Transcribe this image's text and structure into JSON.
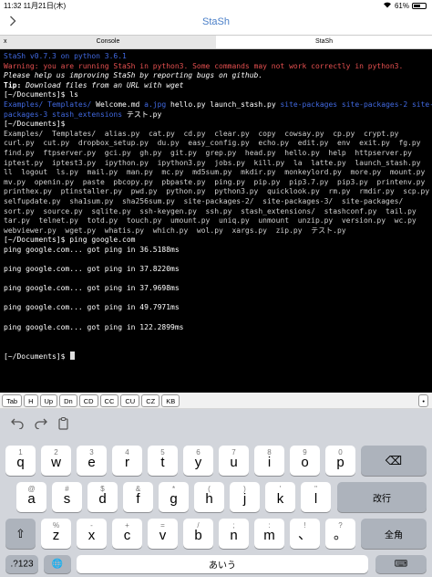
{
  "status_bar": {
    "time": "11:32",
    "date": "11月21日(木)",
    "battery_pct": "61%",
    "battery_level": 0.61
  },
  "nav": {
    "back_icon": "chevron-right-icon",
    "title": "StaSh"
  },
  "tabs": [
    {
      "label": "Console",
      "close": "x",
      "active": false
    },
    {
      "label": "StaSh",
      "active": true
    }
  ],
  "terminal": {
    "lines": [
      {
        "segments": [
          {
            "t": "StaSh v0.7.3 on python 3.6.1",
            "c": "blue"
          }
        ]
      },
      {
        "segments": [
          {
            "t": "Warning: you are running StaSh in python3. Some commands may not work correctly in python3.",
            "c": "red"
          }
        ]
      },
      {
        "segments": [
          {
            "t": "Please help us improving StaSh by reporting bugs on github.",
            "c": "white",
            "i": true
          }
        ]
      },
      {
        "segments": [
          {
            "t": "Tip: ",
            "c": "white",
            "b": true
          },
          {
            "t": "Download files from an URL with wget",
            "c": "white",
            "i": true
          }
        ]
      },
      {
        "segments": [
          {
            "t": "[~/Documents]$ ls",
            "c": "white"
          }
        ]
      },
      {
        "segments": [
          {
            "t": "Examples/ Templates/ ",
            "c": "blue"
          },
          {
            "t": "Welcome.md ",
            "c": "white"
          },
          {
            "t": "a.jpg ",
            "c": "blue"
          },
          {
            "t": "hello.py launch_stash.py ",
            "c": "white"
          },
          {
            "t": "site-packages site-packages-2 site-",
            "c": "blue"
          }
        ]
      },
      {
        "segments": [
          {
            "t": "packages-3 stash_extensions ",
            "c": "blue"
          },
          {
            "t": "テスト.py",
            "c": "white"
          }
        ]
      },
      {
        "segments": [
          {
            "t": "[~/Documents]$",
            "c": "white"
          }
        ]
      },
      {
        "segments": [
          {
            "t": "Examples/  Templates/  alias.py  cat.py  cd.py  clear.py  copy  cowsay.py  cp.py  crypt.py",
            "c": "gray"
          }
        ]
      },
      {
        "segments": [
          {
            "t": "curl.py  cut.py  dropbox_setup.py  du.py  easy_config.py  echo.py  edit.py  env  exit.py  fg.py",
            "c": "gray"
          }
        ]
      },
      {
        "segments": [
          {
            "t": "find.py  ftpserver.py  gci.py  gh.py  git.py  grep.py  head.py  hello.py  help  httpserver.py",
            "c": "gray"
          }
        ]
      },
      {
        "segments": [
          {
            "t": "iptest.py  iptest3.py  ipython.py  ipython3.py  jobs.py  kill.py  la  latte.py  launch_stash.py",
            "c": "gray"
          }
        ]
      },
      {
        "segments": [
          {
            "t": "ll  logout  ls.py  mail.py  man.py  mc.py  md5sum.py  mkdir.py  monkeylord.py  more.py  mount.py",
            "c": "gray"
          }
        ]
      },
      {
        "segments": [
          {
            "t": "mv.py  openin.py  paste  pbcopy.py  pbpaste.py  ping.py  pip.py  pip3.7.py  pip3.py  printenv.py",
            "c": "gray"
          }
        ]
      },
      {
        "segments": [
          {
            "t": "printhex.py  ptinstaller.py  pwd.py  python.py  python3.py  quicklook.py  rm.py  rmdir.py  scp.py",
            "c": "gray"
          }
        ]
      },
      {
        "segments": [
          {
            "t": "selfupdate.py  sha1sum.py  sha256sum.py  site-packages-2/  site-packages-3/  site-packages/",
            "c": "gray"
          }
        ]
      },
      {
        "segments": [
          {
            "t": "sort.py  source.py  sqlite.py  ssh-keygen.py  ssh.py  stash_extensions/  stashconf.py  tail.py",
            "c": "gray"
          }
        ]
      },
      {
        "segments": [
          {
            "t": "tar.py  telnet.py  totd.py  touch.py  umount.py  uniq.py  unmount  unzip.py  version.py  wc.py",
            "c": "gray"
          }
        ]
      },
      {
        "segments": [
          {
            "t": "webviewer.py  wget.py  whatis.py  which.py  wol.py  xargs.py  zip.py  テスト.py",
            "c": "gray"
          }
        ]
      },
      {
        "segments": [
          {
            "t": "[~/Documents]$ ping google.com",
            "c": "white"
          }
        ]
      },
      {
        "segments": [
          {
            "t": "ping google.com... got ping in 36.5188ms",
            "c": "white"
          }
        ]
      },
      {
        "segments": [
          {
            "t": "",
            "c": "white"
          }
        ]
      },
      {
        "segments": [
          {
            "t": "ping google.com... got ping in 37.8220ms",
            "c": "white"
          }
        ]
      },
      {
        "segments": [
          {
            "t": "",
            "c": "white"
          }
        ]
      },
      {
        "segments": [
          {
            "t": "ping google.com... got ping in 37.9698ms",
            "c": "white"
          }
        ]
      },
      {
        "segments": [
          {
            "t": "",
            "c": "white"
          }
        ]
      },
      {
        "segments": [
          {
            "t": "ping google.com... got ping in 49.7971ms",
            "c": "white"
          }
        ]
      },
      {
        "segments": [
          {
            "t": "",
            "c": "white"
          }
        ]
      },
      {
        "segments": [
          {
            "t": "ping google.com... got ping in 122.2899ms",
            "c": "white"
          }
        ]
      },
      {
        "segments": [
          {
            "t": "",
            "c": "white"
          }
        ]
      },
      {
        "segments": [
          {
            "t": "",
            "c": "white"
          }
        ]
      },
      {
        "segments": [
          {
            "t": "[~/Documents]$ ",
            "c": "white"
          }
        ],
        "cursor": true
      }
    ]
  },
  "extra_keys": [
    "Tab",
    "H",
    "Up",
    "Dn",
    "CD",
    "CC",
    "CU",
    "CZ",
    "KB"
  ],
  "extra_keys_more": "•",
  "kb_tools": {
    "undo_icon": "undo-icon",
    "redo_icon": "redo-icon",
    "paste_icon": "clipboard-icon"
  },
  "keyboard": {
    "row1": [
      {
        "main": "q",
        "sub": "1"
      },
      {
        "main": "w",
        "sub": "2"
      },
      {
        "main": "e",
        "sub": "3"
      },
      {
        "main": "r",
        "sub": "4"
      },
      {
        "main": "t",
        "sub": "5"
      },
      {
        "main": "y",
        "sub": "6"
      },
      {
        "main": "u",
        "sub": "7"
      },
      {
        "main": "i",
        "sub": "8"
      },
      {
        "main": "o",
        "sub": "9"
      },
      {
        "main": "p",
        "sub": "0"
      }
    ],
    "delete": "⌫",
    "row2": [
      {
        "main": "a",
        "sub": "@"
      },
      {
        "main": "s",
        "sub": "#"
      },
      {
        "main": "d",
        "sub": "$"
      },
      {
        "main": "f",
        "sub": "&"
      },
      {
        "main": "g",
        "sub": "*"
      },
      {
        "main": "h",
        "sub": "("
      },
      {
        "main": "j",
        "sub": ")"
      },
      {
        "main": "k",
        "sub": "'"
      },
      {
        "main": "l",
        "sub": "\""
      }
    ],
    "return": "改行",
    "shift": "⇧",
    "row3": [
      {
        "main": "z",
        "sub": "%"
      },
      {
        "main": "x",
        "sub": "-"
      },
      {
        "main": "c",
        "sub": "+"
      },
      {
        "main": "v",
        "sub": "="
      },
      {
        "main": "b",
        "sub": "/"
      },
      {
        "main": "n",
        "sub": ";"
      },
      {
        "main": "m",
        "sub": ":"
      },
      {
        "main": "、",
        "sub": "!"
      },
      {
        "main": "。",
        "sub": "?"
      }
    ],
    "fullwidth": "全角",
    "numbers": ".?123",
    "globe": "🌐",
    "space": "あいう",
    "dismiss": "⌨"
  }
}
